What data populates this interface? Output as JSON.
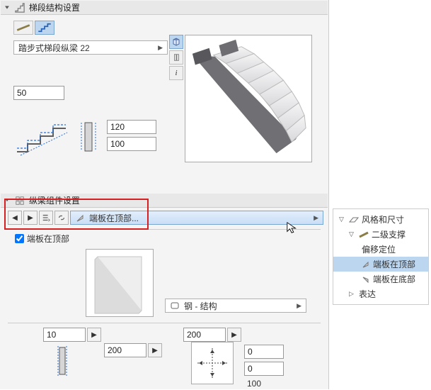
{
  "sections": {
    "segment": {
      "title": "梯段结构设置"
    },
    "component": {
      "title": "纵梁组件设置"
    }
  },
  "stringer": {
    "combo_label": "踏步式梯段纵梁 22",
    "width": "50",
    "profile_h": "120",
    "profile_w": "100"
  },
  "component_bar": {
    "combo_label": "端板在顶部..."
  },
  "checkbox": {
    "label": "端板在顶部"
  },
  "material": {
    "combo_label": "钢 - 结构"
  },
  "plate": {
    "thickness": "10",
    "width": "200",
    "height": "200",
    "off_x": "0",
    "off_y": "0",
    "off_below": "100"
  },
  "tree": {
    "root": "风格和尺寸",
    "n1": "二级支撑",
    "n2": "偏移定位",
    "n3": "端板在顶部",
    "n4": "端板在底部",
    "n5": "表达"
  }
}
